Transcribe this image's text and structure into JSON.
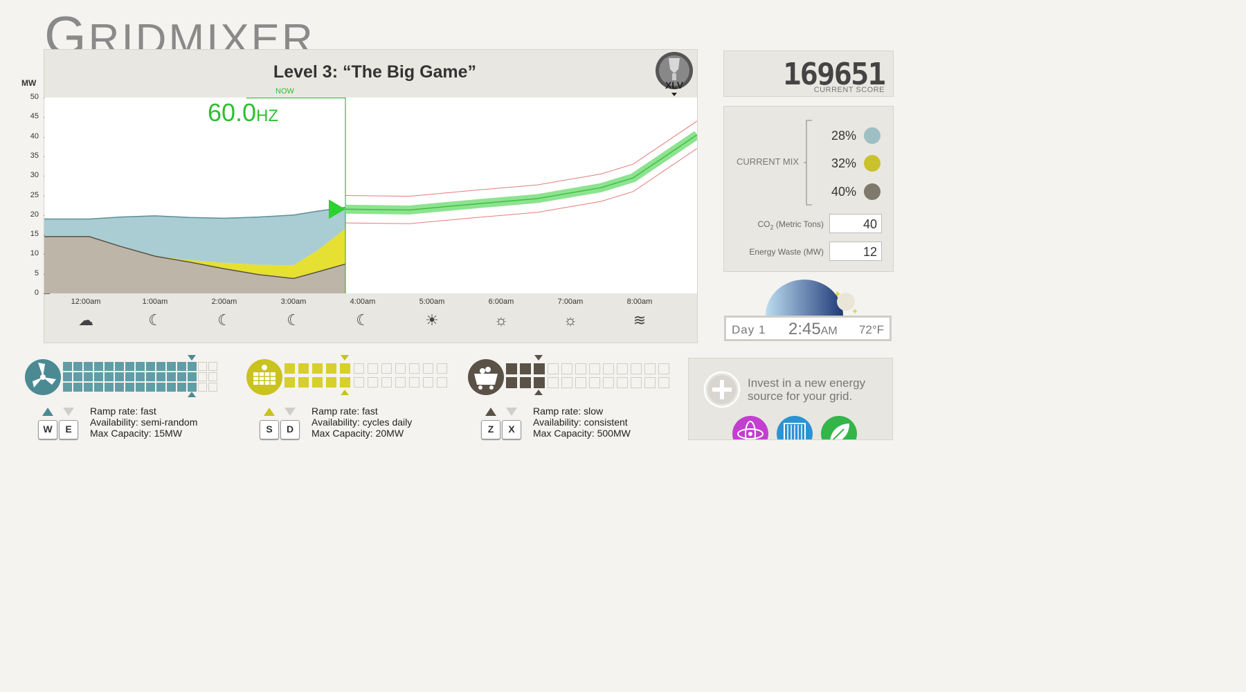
{
  "app": {
    "title_prefix": "G",
    "title_rest": "RIDMIXER"
  },
  "level": {
    "title": "Level 3: “The Big Game”",
    "badge_text": "XLV"
  },
  "score": {
    "value": "169651",
    "label": "CURRENT SCORE"
  },
  "frequency": {
    "value": "60.0",
    "unit": "HZ"
  },
  "now_label": "NOW",
  "current_mix": {
    "label": "CURRENT MIX",
    "items": [
      {
        "percent": "28%",
        "color": "#9ebfc4"
      },
      {
        "percent": "32%",
        "color": "#c9c12e"
      },
      {
        "percent": "40%",
        "color": "#7f786c"
      }
    ]
  },
  "metrics": {
    "co2_label_main": "CO",
    "co2_label_sub": "2",
    "co2_label_rest": " (Metric Tons)",
    "co2_value": "40",
    "waste_label": "Energy Waste (MW)",
    "waste_value": "12"
  },
  "clock": {
    "day": "Day 1",
    "time": "2:45",
    "ampm": "AM",
    "temp": "72°F"
  },
  "weather_icons": [
    "cloud-night-icon",
    "moon-icon",
    "moon-icon",
    "moon-icon",
    "moon-icon",
    "sunrise-icon",
    "sun-icon",
    "sun-icon",
    "wind-icon"
  ],
  "sources": [
    {
      "name": "wind",
      "icon": "wind-turbine-icon",
      "color": "#4b8a93",
      "light": "#5f9ea6",
      "up_key": "W",
      "down_key": "E",
      "ramp": "Ramp rate: fast",
      "availability": "Availability: semi-random",
      "capacity": "Max Capacity: 15MW",
      "cols": 15,
      "filled": 13
    },
    {
      "name": "solar",
      "icon": "solar-panel-icon",
      "color": "#c9c21f",
      "light": "#d6cf2f",
      "up_key": "S",
      "down_key": "D",
      "ramp": "Ramp rate: fast",
      "availability": "Availability: cycles daily",
      "capacity": "Max Capacity: 20MW",
      "cols": 12,
      "filled": 5
    },
    {
      "name": "coal",
      "icon": "coal-cart-icon",
      "color": "#5a5147",
      "light": "#5a5147",
      "up_key": "Z",
      "down_key": "X",
      "ramp": "Ramp rate: slow",
      "availability": "Availability: consistent",
      "capacity": "Max Capacity: 500MW",
      "cols": 12,
      "filled": 3
    }
  ],
  "invest": {
    "text": "Invest in a new energy source for your grid.",
    "options": [
      {
        "icon": "atom-icon",
        "color": "#c23fcf"
      },
      {
        "icon": "hydro-icon",
        "color": "#2a93d3"
      },
      {
        "icon": "leaf-icon",
        "color": "#33b54a"
      }
    ]
  },
  "chart_data": {
    "type": "area",
    "ylabel": "MW",
    "ylim": [
      0,
      50
    ],
    "yticks": [
      0,
      5,
      10,
      15,
      20,
      25,
      30,
      35,
      40,
      45,
      50
    ],
    "x_ticks": [
      "12:00am",
      "1:00am",
      "2:00am",
      "3:00am",
      "4:00am",
      "5:00am",
      "6:00am",
      "7:00am",
      "8:00am"
    ],
    "x_hours": [
      -0.95,
      -0.5,
      0,
      0.5,
      1,
      1.5,
      2,
      2.35,
      2.75
    ],
    "series": [
      {
        "name": "",
        "values": [
          14.5,
          12,
          9.5,
          8,
          6.3,
          4.8,
          3.8,
          5.5,
          7.5
        ],
        "color": "#bdb5a8"
      },
      {
        "name": "",
        "values": [
          14.5,
          12,
          9.5,
          8.5,
          7.8,
          7.3,
          7.2,
          11,
          16.5
        ],
        "color": "#e5e031"
      },
      {
        "name": "",
        "values": [
          19,
          19.5,
          19.8,
          19.4,
          19.2,
          19.5,
          20,
          21,
          22
        ],
        "color": "#a9cdd2"
      }
    ],
    "demand_forecast": {
      "x_hours": [
        3,
        4,
        5,
        6,
        7,
        7.5,
        8,
        8.5
      ],
      "values": [
        21.5,
        21.3,
        22.8,
        24.2,
        27,
        29.5,
        35,
        40.5
      ]
    },
    "now_hour": 2.75
  }
}
